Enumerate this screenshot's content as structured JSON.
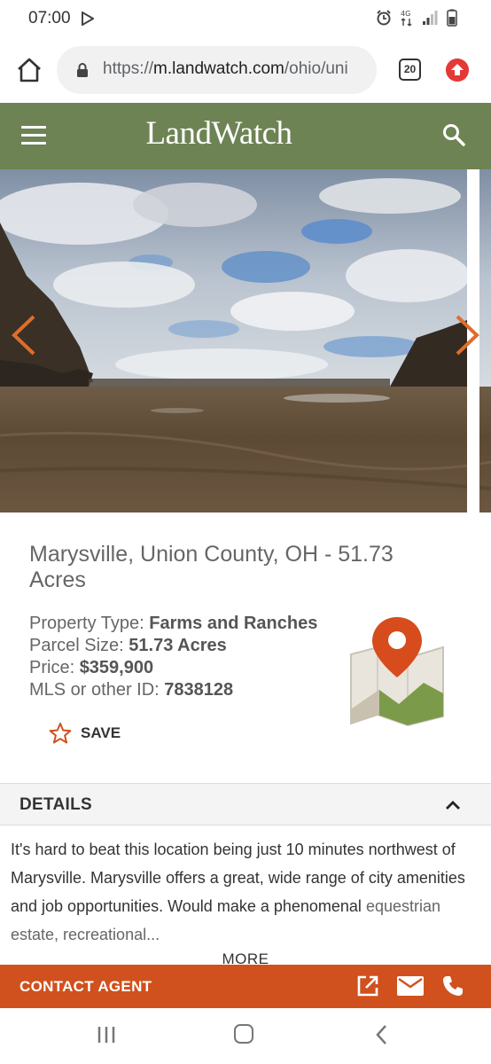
{
  "status_bar": {
    "time": "07:00",
    "icons": [
      "play-icon",
      "alarm-icon",
      "data-icon",
      "signal-icon",
      "battery-icon"
    ]
  },
  "browser": {
    "url_prefix": "https://",
    "url_host": "m.landwatch.com",
    "url_path": "/ohio/uni",
    "tab_count": "20",
    "icons": [
      "home-icon",
      "lock-icon",
      "upgrade-icon"
    ]
  },
  "header": {
    "logo": "LandWatch",
    "brand_color": "#6d8354",
    "icons": [
      "menu-icon",
      "search-icon"
    ]
  },
  "gallery": {
    "icons": [
      "chevron-left-icon",
      "chevron-right-icon"
    ],
    "accent_color": "#e06d2b"
  },
  "listing": {
    "title": "Marysville, Union County, OH - 51.73 Acres",
    "property_type_label": "Property Type: ",
    "property_type_value": "Farms and Ranches",
    "parcel_size_label": "Parcel Size: ",
    "parcel_size_value": "51.73 Acres",
    "price_label": "Price: ",
    "price_value": "$359,900",
    "mls_label": "MLS or other ID: ",
    "mls_value": "7838128",
    "save_label": "SAVE"
  },
  "details": {
    "title": "DETAILS",
    "body": "It's hard to beat this location being just 10 minutes northwest of Marysville. Marysville offers a great, wide range of city amenities and job opportunities. Would make a phenomenal",
    "body_faded": "equestrian estate, recreational...",
    "more_label": "MORE"
  },
  "contact": {
    "label": "CONTACT AGENT",
    "color": "#d0511d",
    "icons": [
      "external-link-icon",
      "mail-icon",
      "phone-icon"
    ]
  },
  "nav": {
    "icons": [
      "recent-apps-icon",
      "home-button-icon",
      "back-icon"
    ]
  }
}
